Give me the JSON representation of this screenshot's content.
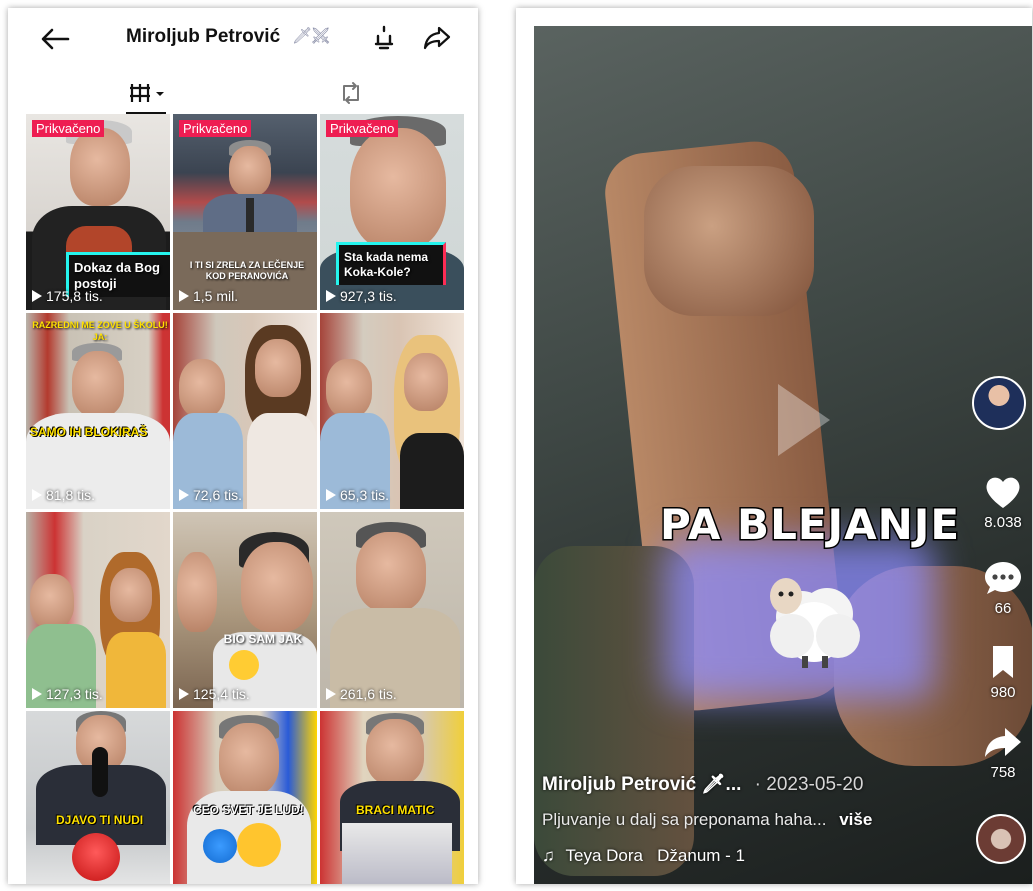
{
  "profile": {
    "title": "Miroljub Petrović",
    "title_emoji": "🗡⚔",
    "tiles": [
      {
        "pinned": "Prikvačeno",
        "views": "175,8 tis.",
        "caption": "Dokaz da Bog postoji"
      },
      {
        "pinned": "Prikvačeno",
        "views": "1,5 mil.",
        "caption": "I TI SI ZRELA ZA LEČENJE KOD PERANOVIĆA"
      },
      {
        "pinned": "Prikvačeno",
        "views": "927,3 tis.",
        "caption": "Sta kada nema Koka-Kole?"
      },
      {
        "pinned": "",
        "views": "81,8 tis.",
        "caption": "RAZREDNI ME ZOVE U ŠKOLU! JA:",
        "caption2": "SAMO IH BLOKIRAŠ"
      },
      {
        "pinned": "",
        "views": "72,6 tis.",
        "caption": ""
      },
      {
        "pinned": "",
        "views": "65,3 tis.",
        "caption": ""
      },
      {
        "pinned": "",
        "views": "127,3 tis.",
        "caption": ""
      },
      {
        "pinned": "",
        "views": "125,4 tis.",
        "caption": "BIO SAM JAK"
      },
      {
        "pinned": "",
        "views": "261,6 tis.",
        "caption": ""
      },
      {
        "pinned": "",
        "views": "",
        "caption": "DJAVO TI NUDI"
      },
      {
        "pinned": "",
        "views": "",
        "caption": "CEO SVET JE LUD!"
      },
      {
        "pinned": "",
        "views": "",
        "caption": "BRACI MATIC"
      }
    ]
  },
  "player": {
    "sticker_text": "PA BLEJANJE",
    "likes": "8.038",
    "comments": "66",
    "saves": "980",
    "shares": "758",
    "author": "Miroljub Petrović",
    "author_suffix": "🗡...",
    "date": "· 2023-05-20",
    "description": "Pljuvanje u dalj sa preponama haha...",
    "more": "više",
    "music": "Teya Dora   Džanum - 1",
    "music_icon": "♫"
  }
}
